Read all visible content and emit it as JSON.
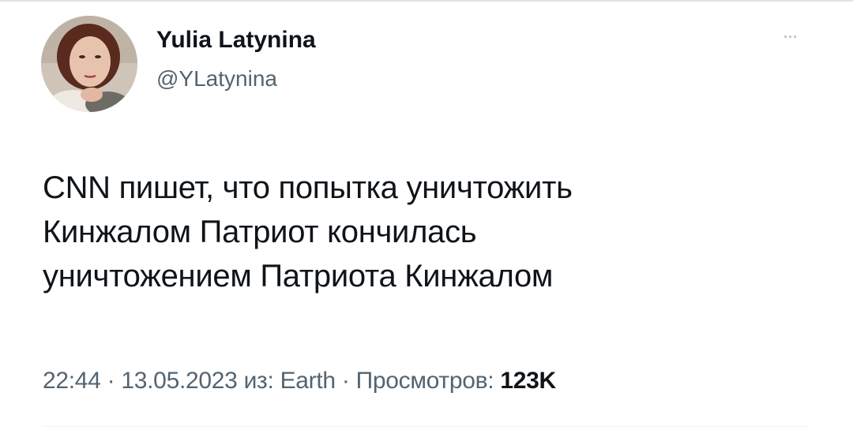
{
  "author": {
    "display_name": "Yulia Latynina",
    "handle": "@YLatynina",
    "avatar_icon": "user-photo-avatar"
  },
  "more_icon": "more-horizontal-icon",
  "tweet": {
    "lines": [
      "CNN пишет, что попытка уничтожить",
      "Кинжалом Патриот кончилась",
      "уничтожением Патриота Кинжалом"
    ]
  },
  "meta": {
    "time": "22:44",
    "separator": "·",
    "date": "13.05.2023",
    "source_prefix": "из:",
    "source": "Earth",
    "views_label": "Просмотров:",
    "views_count": "123K"
  },
  "colors": {
    "text_primary": "#0f1419",
    "text_secondary": "#536471",
    "background": "#ffffff"
  }
}
